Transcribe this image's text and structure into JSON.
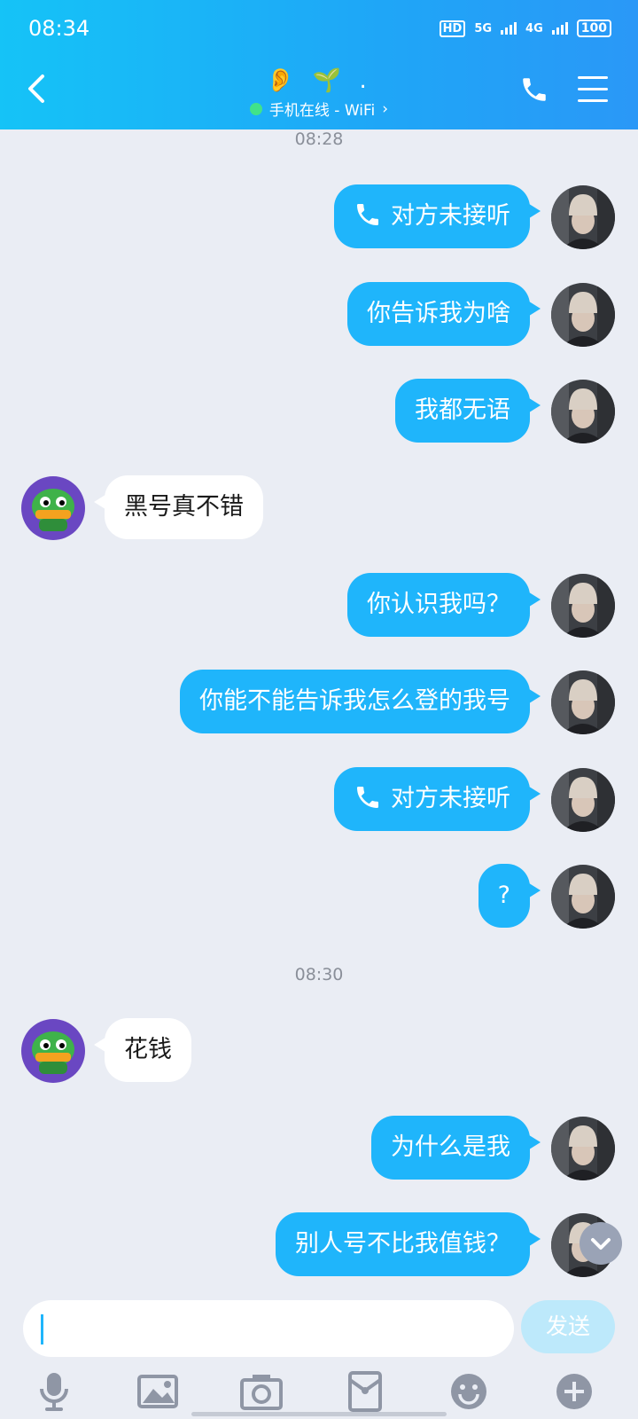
{
  "status": {
    "time": "08:34",
    "hd": "HD",
    "net1": "5G",
    "net2": "4G",
    "battery": "100"
  },
  "header": {
    "title": "👂 🌱 .",
    "online_status": "手机在线 - WiFi",
    "chevron": "›"
  },
  "timestamps": [
    "08:28",
    "08:30"
  ],
  "messages": [
    {
      "dir": "out",
      "text": "对方未接听",
      "call": true
    },
    {
      "dir": "out",
      "text": "你告诉我为啥"
    },
    {
      "dir": "out",
      "text": "我都无语"
    },
    {
      "dir": "in",
      "text": "黑号真不错"
    },
    {
      "dir": "out",
      "text": "你认识我吗？"
    },
    {
      "dir": "out",
      "text": "你能不能告诉我怎么登的我号"
    },
    {
      "dir": "out",
      "text": "对方未接听",
      "call": true
    },
    {
      "dir": "out",
      "text": "?"
    },
    {
      "dir": "in",
      "text": "花钱"
    },
    {
      "dir": "out",
      "text": "为什么是我"
    },
    {
      "dir": "out",
      "text": "别人号不比我值钱？"
    }
  ],
  "input": {
    "value": ""
  },
  "send_label": "发送",
  "toolbar_icons": [
    "microphone-icon",
    "image-icon",
    "camera-icon",
    "red-packet-icon",
    "emoji-icon",
    "plus-icon"
  ],
  "colors": {
    "header": "#1fa6f7",
    "bubble_out": "#1fb5fb",
    "background": "#eaedf4"
  }
}
